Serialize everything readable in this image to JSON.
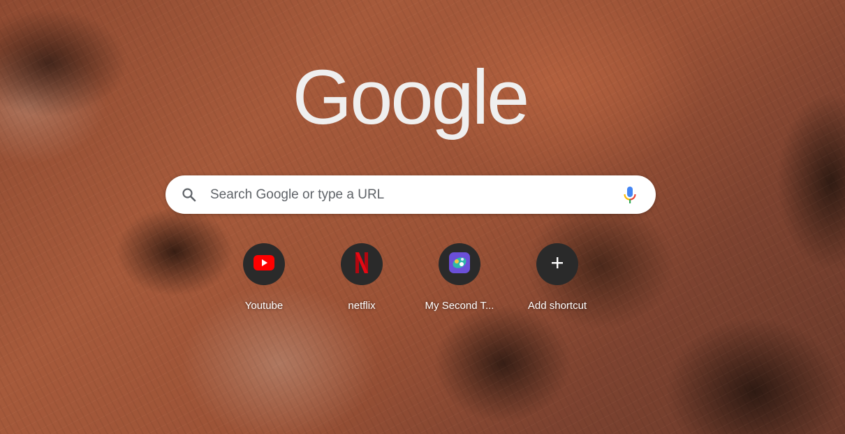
{
  "logo": {
    "text": "Google"
  },
  "search": {
    "placeholder": "Search Google or type a URL"
  },
  "icons": {
    "search": "search-icon",
    "mic": "mic-icon",
    "add": "plus-icon"
  },
  "shortcuts": [
    {
      "title": "Youtube",
      "icon": "youtube-icon"
    },
    {
      "title": "netflix",
      "icon": "netflix-icon"
    },
    {
      "title": "My Second T...",
      "icon": "site-favicon"
    },
    {
      "title": "Add shortcut",
      "icon": "plus-icon"
    }
  ],
  "colors": {
    "logo": "#efefef",
    "tile_background": "#2a2a2a",
    "youtube_red": "#ff0000",
    "netflix_red": "#e50914",
    "mic_blue": "#4285f4",
    "mic_red": "#ea4335",
    "mic_yellow": "#fbbc04",
    "mic_green": "#34a853"
  }
}
